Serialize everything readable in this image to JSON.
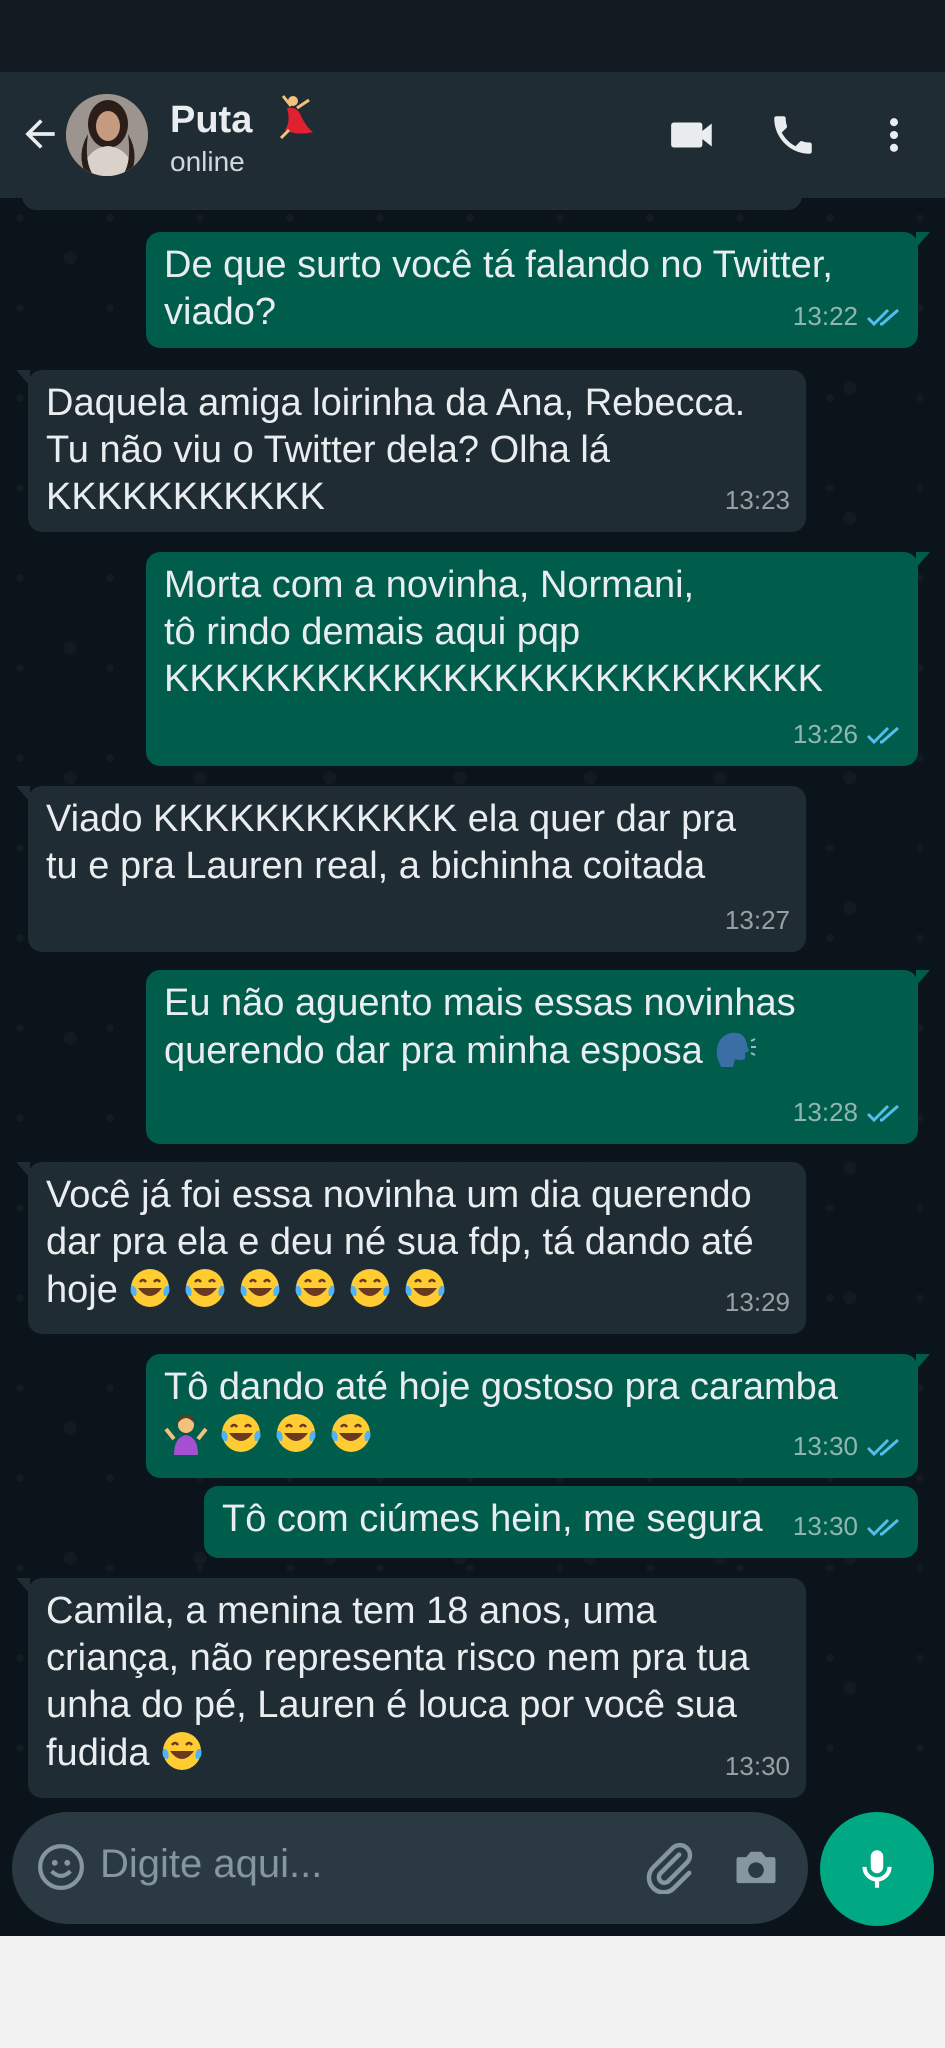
{
  "header": {
    "contact_name": "Puta",
    "contact_status": "online",
    "icons": [
      "back-arrow-icon",
      "video-call-icon",
      "phone-icon",
      "more-vert-icon"
    ]
  },
  "messages": [
    {
      "dir": "out",
      "text": "De que surto você tá falando no Twitter,\nviado?",
      "time": "13:22",
      "read": true
    },
    {
      "dir": "in",
      "text": "Daquela amiga loirinha da Ana, Rebecca.\nTu não viu o Twitter dela? Olha lá\nKKKKKKKKKKK",
      "time": "13:23"
    },
    {
      "dir": "out",
      "text": "Morta com a novinha, Normani,\ntô rindo demais aqui pqp\nKKKKKKKKKKKKKKKKKKKKKKKKKK",
      "time": "13:26",
      "read": true
    },
    {
      "dir": "in",
      "text": "Viado KKKKKKKKKKKK ela quer dar pra\ntu e pra Lauren real, a bichinha coitada",
      "time": "13:27"
    },
    {
      "dir": "out",
      "text": "Eu não aguento mais essas novinhas\nquerendo dar pra minha esposa",
      "time": "13:28",
      "read": true,
      "emoji": "speaking-head"
    },
    {
      "dir": "in",
      "text": "Você já foi essa novinha um dia querendo\ndar pra ela e deu né sua fdp, tá dando até\nhoje",
      "time": "13:29",
      "emoji": "laughing-x6"
    },
    {
      "dir": "out",
      "text": "Tô dando até hoje gostoso pra caramba",
      "time": "13:30",
      "read": true,
      "emoji": "shrug-laughing-x3"
    },
    {
      "dir": "out",
      "text": "Tô com ciúmes hein, me segura",
      "time": "13:30",
      "read": true
    },
    {
      "dir": "in",
      "text": "Camila, a menina tem 18 anos, uma\ncriança, não representa risco nem pra tua\nunha do pé, Lauren é louca por você sua\nfudida",
      "time": "13:30",
      "emoji": "laughing"
    }
  ],
  "composer": {
    "placeholder": "Digite aqui...",
    "icons": [
      "emoji-icon",
      "attach-icon",
      "camera-icon",
      "mic-icon"
    ]
  },
  "colors": {
    "outgoing_bubble": "#005c4b",
    "incoming_bubble": "#202c33",
    "header": "#202c33",
    "background": "#0b141a",
    "accent": "#00a884",
    "read_ticks": "#53bdeb"
  }
}
